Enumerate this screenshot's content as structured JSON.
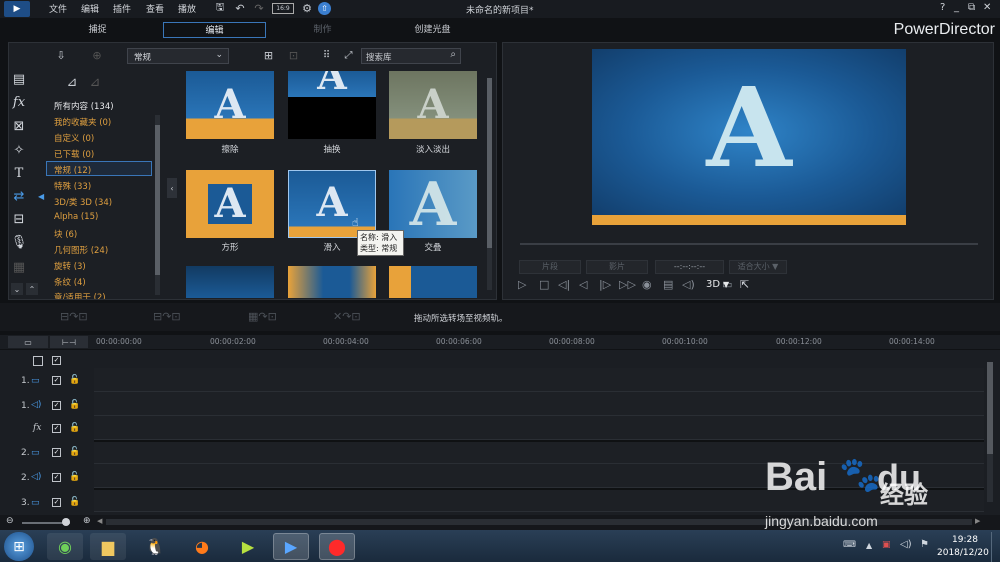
{
  "window": {
    "title": "未命名的新项目*",
    "menus": [
      "文件",
      "编辑",
      "插件",
      "查看",
      "播放"
    ],
    "brand": "PowerDirector",
    "controls": [
      "?",
      "_",
      "⧉",
      "✕"
    ]
  },
  "mode_tabs": [
    "捕捉",
    "编辑",
    "制作",
    "创建光盘"
  ],
  "library": {
    "filter_value": "常规",
    "search_placeholder": "搜索库",
    "categories": [
      "所有内容 (134)",
      "我的收藏夹 (0)",
      "自定义 (0)",
      "已下载 (0)",
      "常规 (12)",
      "特殊 (33)",
      "3D/类 3D (34)",
      "Alpha (15)",
      "块 (6)",
      "几何图形 (24)",
      "旋转 (3)",
      "条纹 (4)",
      "章/适用于 (2)"
    ],
    "transitions": [
      {
        "name": "擦除"
      },
      {
        "name": "抽换"
      },
      {
        "name": "淡入淡出"
      },
      {
        "name": "方形"
      },
      {
        "name": "滑入"
      },
      {
        "name": "交叠"
      }
    ],
    "tooltip": {
      "line1": "名称: 滑入",
      "line2": "类型: 常规"
    }
  },
  "preview": {
    "letter": "A",
    "btn_clip": "片段",
    "btn_movie": "影片",
    "timecode": "--:--:--:--",
    "fit": "适合大小 ▼",
    "mode3d": "3D"
  },
  "status": {
    "hint": "拖动所选转场至视频轨。"
  },
  "timeline": {
    "ruler": [
      "00:00:00:00",
      "00:00:02:00",
      "00:00:04:00",
      "00:00:06:00",
      "00:00:08:00",
      "00:00:10:00",
      "00:00:12:00",
      "00:00:14:00"
    ],
    "tracks": [
      "1.",
      "1.",
      "fx",
      "2.",
      "2.",
      "3."
    ]
  },
  "taskbar": {
    "time": "19:28",
    "date": "2018/12/20"
  },
  "watermark": {
    "text1": "Bai",
    "text2": "du",
    "text3": "经验",
    "url": "jingyan.baidu.com"
  },
  "colors": {
    "accent": "#3a76b8",
    "category": "#e0a040",
    "thumb_blue": "#1b5a96",
    "thumb_orange": "#e8a23a"
  }
}
